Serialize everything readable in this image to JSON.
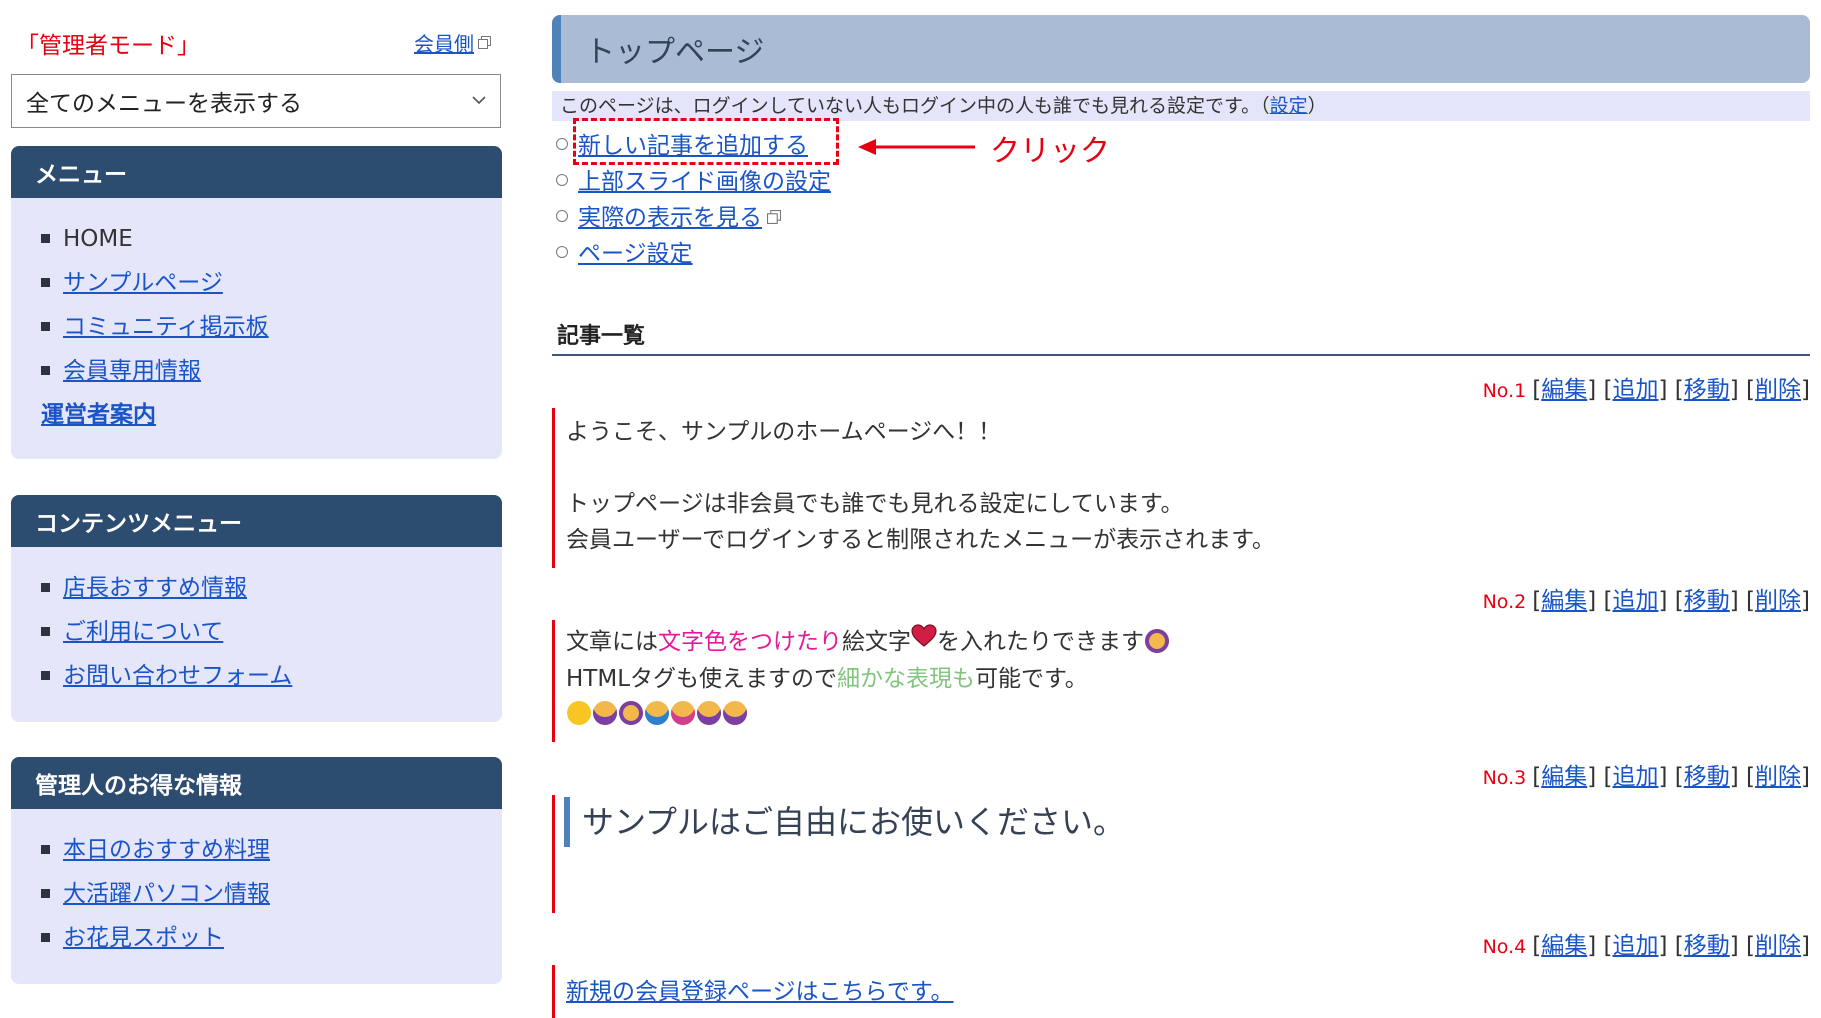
{
  "header": {
    "admin_mode": "「管理者モード」",
    "member_view": "会員側"
  },
  "menu_select": {
    "selected": "全てのメニューを表示する"
  },
  "sidebar": {
    "boxes": [
      {
        "title": "メニュー",
        "items": [
          "HOME",
          "サンプルページ",
          "コミュニティ掲示板",
          "会員専用情報"
        ],
        "extra_link": "運営者案内"
      },
      {
        "title": "コンテンツメニュー",
        "items": [
          "店長おすすめ情報",
          "ご利用について",
          "お問い合わせフォーム"
        ]
      },
      {
        "title": "管理人のお得な情報",
        "items": [
          "本日のおすすめ料理",
          "大活躍パソコン情報",
          "お花見スポット"
        ]
      }
    ]
  },
  "main": {
    "page_title": "トップページ",
    "visibility_text": "このページは、ログインしていない人もログイン中の人も誰でも見れる設定です。（",
    "visibility_link": "設定",
    "visibility_close": "）",
    "actions": [
      "新しい記事を追加する",
      "上部スライド画像の設定",
      "実際の表示を見る",
      "ページ設定"
    ],
    "annotation": "クリック",
    "list_title": "記事一覧",
    "toolbar": {
      "edit": "編集",
      "add": "追加",
      "move": "移動",
      "delete": "削除"
    },
    "articles": [
      {
        "no": "No.1",
        "lines": [
          "ようこそ、サンプルのホームページへ！！",
          "トップページは非会員でも誰でも見れる設定にしています。",
          "会員ユーザーでログインすると制限されたメニューが表示されます。"
        ]
      },
      {
        "no": "No.2",
        "line1_a": "文章には",
        "line1_pink": "文字色をつけたり",
        "line1_b": "絵文字",
        "line1_c": "を入れたりできます",
        "line2_a": "HTMLタグも使えますので",
        "line2_green": "細かな表現も",
        "line2_b": "可能です。"
      },
      {
        "no": "No.3",
        "heading": "サンプルはご自由にお使いください。"
      },
      {
        "no": "No.4",
        "link": "新規の会員登録ページはこちらです。"
      }
    ]
  },
  "colors": {
    "accent_red": "#e60012",
    "nav_head": "#2d4d70",
    "link": "#1a55c8",
    "box_bg": "#e6e6fb"
  }
}
